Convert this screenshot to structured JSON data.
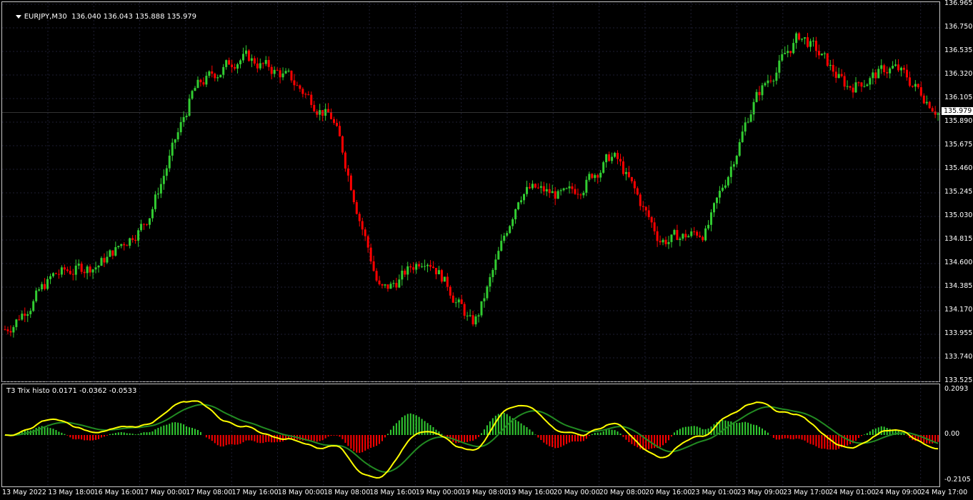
{
  "chart": {
    "symbol": "EURJPY,M30",
    "ohlc": "136.040 136.043 135.888 135.979",
    "current_price": "135.979",
    "colors": {
      "bull": "#32cd32",
      "bear": "#ff0000",
      "background": "#000000",
      "grid": "#1e1e32",
      "trix_line": "#ffff00",
      "signal_line": "#228b22",
      "histo_up": "#32cd32",
      "histo_down": "#ff0000"
    },
    "price_axis": [
      "136.965",
      "136.750",
      "136.535",
      "136.320",
      "136.105",
      "135.890",
      "135.675",
      "135.460",
      "135.245",
      "135.030",
      "134.815",
      "134.600",
      "134.385",
      "134.170",
      "133.955",
      "133.740",
      "133.525"
    ],
    "time_axis": [
      "13 May 2022",
      "13 May 18:00",
      "16 May 16:00",
      "17 May 00:00",
      "17 May 08:00",
      "17 May 16:00",
      "18 May 00:00",
      "18 May 08:00",
      "18 May 16:00",
      "19 May 00:00",
      "19 May 08:00",
      "19 May 16:00",
      "20 May 00:00",
      "20 May 08:00",
      "20 May 16:00",
      "23 May 01:00",
      "23 May 09:00",
      "23 May 17:00",
      "24 May 01:00",
      "24 May 09:00",
      "24 May 17:00"
    ]
  },
  "indicator": {
    "name": "T3 Trix histo 0.0171 -0.0362 -0.0533",
    "axis": [
      "0.2093",
      "0.00",
      "-0.2105"
    ]
  },
  "chart_data": {
    "type": "candlestick",
    "title": "EURJPY,M30",
    "ylim": [
      133.525,
      136.965
    ],
    "approx_close_path": [
      [
        "13 May 2022",
        134.0
      ],
      [
        "13 May 18:00",
        134.5
      ],
      [
        "16 May 16:00",
        134.6
      ],
      [
        "17 May 00:00",
        135.0
      ],
      [
        "17 May 08:00",
        136.2
      ],
      [
        "17 May 16:00",
        136.5
      ],
      [
        "18 May 00:00",
        136.3
      ],
      [
        "18 May 08:00",
        135.9
      ],
      [
        "18 May 16:00",
        134.3
      ],
      [
        "19 May 00:00",
        134.7
      ],
      [
        "19 May 08:00",
        134.0
      ],
      [
        "19 May 16:00",
        135.3
      ],
      [
        "20 May 00:00",
        135.2
      ],
      [
        "20 May 08:00",
        135.6
      ],
      [
        "20 May 16:00",
        134.8
      ],
      [
        "23 May 01:00",
        134.9
      ],
      [
        "23 May 09:00",
        136.1
      ],
      [
        "23 May 17:00",
        136.7
      ],
      [
        "24 May 01:00",
        136.2
      ],
      [
        "24 May 09:00",
        136.4
      ],
      [
        "24 May 17:00",
        135.979
      ]
    ]
  }
}
